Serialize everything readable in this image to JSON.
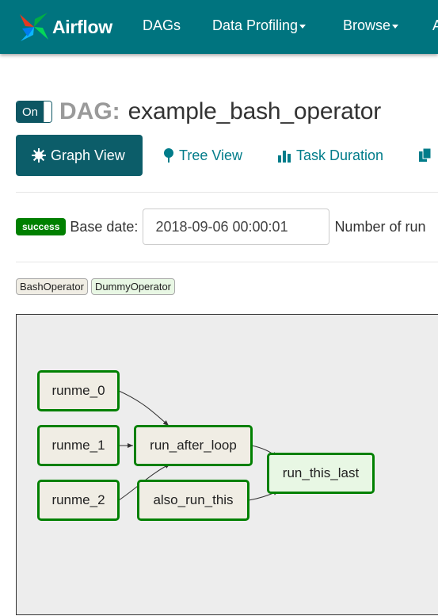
{
  "header": {
    "brand": "Airflow",
    "nav": [
      {
        "label": "DAGs"
      },
      {
        "label": "Data Profiling"
      },
      {
        "label": "Browse"
      },
      {
        "label": "A"
      }
    ]
  },
  "dag": {
    "toggle_label": "On",
    "title_prefix": "DAG:",
    "name": "example_bash_operator"
  },
  "tabs": [
    {
      "label": "Graph View",
      "icon": "gear-icon",
      "active": true
    },
    {
      "label": "Tree View",
      "icon": "tree-icon",
      "active": false
    },
    {
      "label": "Task Duration",
      "icon": "bar-chart-icon",
      "active": false
    },
    {
      "label": "",
      "icon": "files-icon",
      "active": false
    }
  ],
  "controls": {
    "status_badge": "success",
    "base_date_label": "Base date:",
    "base_date_value": "2018-09-06 00:00:01",
    "num_runs_label": "Number of run"
  },
  "legend": [
    "BashOperator",
    "DummyOperator"
  ],
  "colors": {
    "navbar": "#00747f",
    "active_tab": "#0c5d69",
    "success": "#008000",
    "bash_operator_fill": "#f0ede4",
    "dummy_operator_fill": "#e8f7e4"
  },
  "graph": {
    "nodes": [
      {
        "id": "runme_0",
        "label": "runme_0",
        "operator": "BashOperator"
      },
      {
        "id": "runme_1",
        "label": "runme_1",
        "operator": "BashOperator"
      },
      {
        "id": "runme_2",
        "label": "runme_2",
        "operator": "BashOperator"
      },
      {
        "id": "run_after_loop",
        "label": "run_after_loop",
        "operator": "BashOperator"
      },
      {
        "id": "also_run_this",
        "label": "also_run_this",
        "operator": "BashOperator"
      },
      {
        "id": "run_this_last",
        "label": "run_this_last",
        "operator": "DummyOperator"
      }
    ],
    "edges": [
      {
        "from": "runme_0",
        "to": "run_after_loop"
      },
      {
        "from": "runme_1",
        "to": "run_after_loop"
      },
      {
        "from": "runme_2",
        "to": "run_after_loop"
      },
      {
        "from": "run_after_loop",
        "to": "run_this_last"
      },
      {
        "from": "also_run_this",
        "to": "run_this_last"
      }
    ]
  }
}
